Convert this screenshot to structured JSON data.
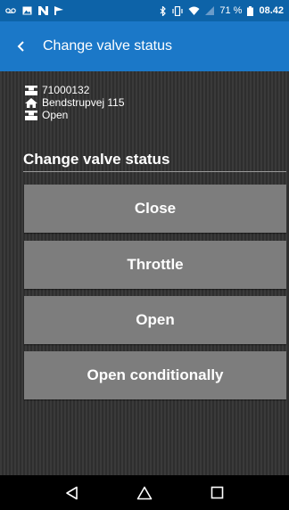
{
  "status_bar": {
    "battery_percent": "71 %",
    "time": "08.42",
    "icons_left": [
      "voicemail-icon",
      "image-icon",
      "n-icon",
      "flag-icon"
    ],
    "icons_right": [
      "bluetooth-icon",
      "vibrate-icon",
      "wifi-icon",
      "signal-icon",
      "battery-icon"
    ]
  },
  "app_bar": {
    "title": "Change valve status",
    "back_icon": "back-chevron-icon"
  },
  "info": {
    "valve_id": "71000132",
    "address": "Bendstrupvej 115",
    "status": "Open"
  },
  "section": {
    "title": "Change valve status"
  },
  "actions": [
    {
      "label": "Close"
    },
    {
      "label": "Throttle"
    },
    {
      "label": "Open"
    },
    {
      "label": "Open conditionally"
    }
  ],
  "nav": {
    "icons": [
      "back-triangle-icon",
      "home-icon",
      "recents-icon"
    ]
  },
  "colors": {
    "status_bar": "#0d63a8",
    "app_bar": "#1b78c8",
    "button": "#7d7d7d",
    "background": "#2e2e2e"
  }
}
